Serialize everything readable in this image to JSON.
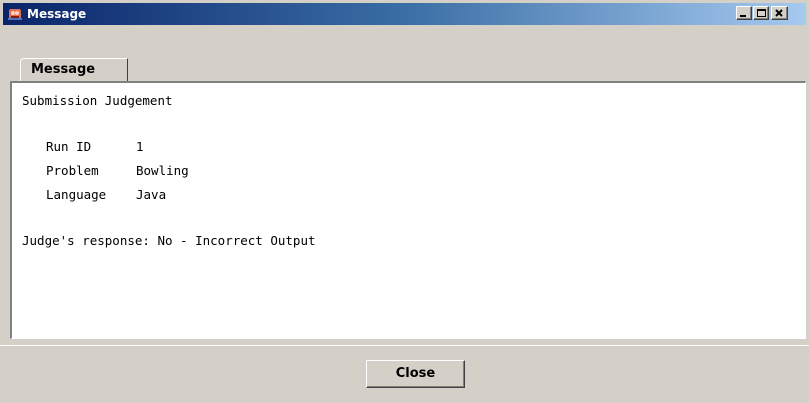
{
  "window": {
    "title": "Message",
    "title_gradient": [
      "#0a246a",
      "#a6caf0"
    ],
    "controls": {
      "minimize": "minimize-icon",
      "maximize": "maximize-icon",
      "close": "close-icon"
    }
  },
  "tabs": [
    {
      "label": "Message",
      "selected": true
    }
  ],
  "message": {
    "heading": "Submission Judgement",
    "fields": [
      {
        "label": "Run ID",
        "value": "1"
      },
      {
        "label": "Problem",
        "value": "Bowling"
      },
      {
        "label": "Language",
        "value": "Java"
      }
    ],
    "response_label": "Judge's response:",
    "response_value": "No - Incorrect Output"
  },
  "buttons": {
    "close_label": "Close"
  }
}
